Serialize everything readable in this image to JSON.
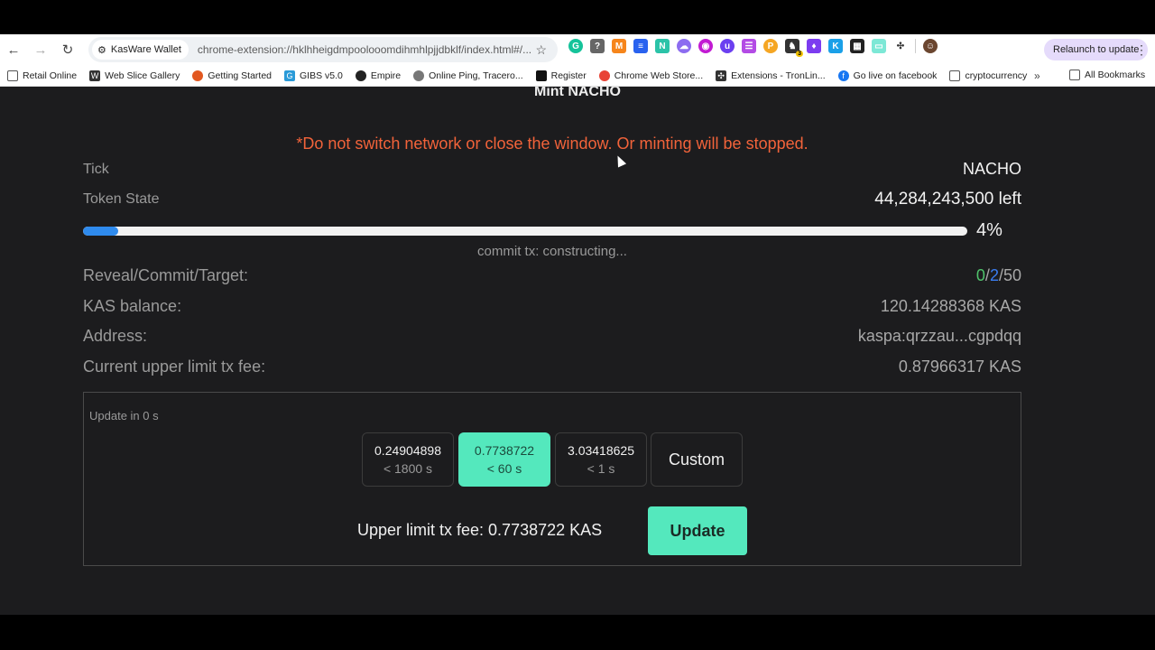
{
  "browser": {
    "tab_chip_label": "KasWare Wallet",
    "url": "chrome-extension://hklhheigdmpoolooomdihmhlpjjdbklf/index.html#/...",
    "relaunch_label": "Relaunch to update",
    "extension_badge": "3"
  },
  "bookmarks": {
    "items": [
      {
        "label": "Retail Online"
      },
      {
        "label": "Web Slice Gallery"
      },
      {
        "label": "Getting Started"
      },
      {
        "label": "GIBS v5.0"
      },
      {
        "label": "Empire"
      },
      {
        "label": "Online Ping, Tracero..."
      },
      {
        "label": "Register"
      },
      {
        "label": "Chrome Web Store..."
      },
      {
        "label": "Extensions - TronLin..."
      },
      {
        "label": "Go live on facebook"
      },
      {
        "label": "cryptocurrency"
      }
    ],
    "more_label": "»",
    "all_label": "All Bookmarks"
  },
  "page": {
    "title": "Mint NACHO",
    "warning": "*Do not switch network or close the window. Or minting will be stopped.",
    "tick_label": "Tick",
    "tick_value": "NACHO",
    "token_state_label": "Token State",
    "token_state_value": "44,284,243,500 left",
    "progress_percent": 4,
    "progress_label": "4%",
    "commit_status": "commit tx: constructing...",
    "rct_label": "Reveal/Commit/Target:",
    "reveal": "0",
    "commit": "2",
    "target": "50",
    "slash": "/",
    "balance_label": "KAS balance:",
    "balance_value": "120.14288368 KAS",
    "address_label": "Address:",
    "address_value": "kaspa:qrzzau...cgpdqq",
    "fee_limit_label": "Current upper limit tx fee:",
    "fee_limit_value": "0.87966317 KAS"
  },
  "fee_panel": {
    "update_in": "Update in 0 s",
    "options": [
      {
        "amount": "0.24904898",
        "time": "< 1800 s",
        "selected": false
      },
      {
        "amount": "0.7738722",
        "time": "< 60 s",
        "selected": true
      },
      {
        "amount": "3.03418625",
        "time": "< 1 s",
        "selected": false
      }
    ],
    "custom_label": "Custom",
    "upper_limit_text": "Upper limit tx fee: 0.7738722 KAS",
    "update_label": "Update"
  },
  "colors": {
    "accent": "#54e8bd",
    "warning": "#f2633a",
    "progress": "#2f8bee",
    "reveal": "#4fc36b",
    "commit": "#3a7df0"
  }
}
